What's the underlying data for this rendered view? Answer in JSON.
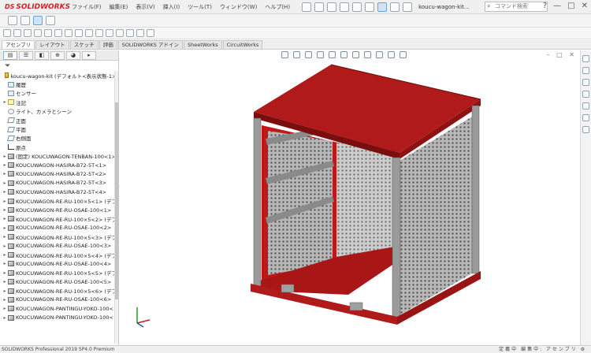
{
  "app": {
    "logo_ds": "DS",
    "logo_text": "SOLIDWORKS",
    "file_name": "koucu-wagon-kit…",
    "search_placeholder": "コマンド検索",
    "window_controls": [
      "?",
      "—",
      "□",
      "✕"
    ]
  },
  "menu": [
    "ファイル(F)",
    "編集(E)",
    "表示(V)",
    "挿入(I)",
    "ツール(T)",
    "ウィンドウ(W)",
    "ヘルプ(H)"
  ],
  "command_tabs": [
    "アセンブリ",
    "レイアウト",
    "スケッチ",
    "評価",
    "SOLIDWORKS アドイン",
    "SheetWorks",
    "CircuitWorks"
  ],
  "feature_manager": {
    "tabs": [
      "FeatureManager",
      "PropertyManager",
      "ConfigurationManager",
      "DimXpert",
      "DisplayManager"
    ],
    "filter_icon": "filter-icon",
    "tree": [
      {
        "label": "koucu-wagon-kit (デフォルト<表示状態-1>)",
        "icon": "assembly",
        "arrow": ""
      },
      {
        "label": "履歴",
        "icon": "history",
        "arrow": ""
      },
      {
        "label": "センサー",
        "icon": "sensor",
        "arrow": ""
      },
      {
        "label": "注記",
        "icon": "note",
        "arrow": "▸"
      },
      {
        "label": "ライト、カメラとシーン",
        "icon": "light",
        "arrow": ""
      },
      {
        "label": "正面",
        "icon": "plane",
        "arrow": ""
      },
      {
        "label": "平面",
        "icon": "plane",
        "arrow": ""
      },
      {
        "label": "右側面",
        "icon": "plane",
        "arrow": ""
      },
      {
        "label": "原点",
        "icon": "origin",
        "arrow": ""
      },
      {
        "label": "(固定) KOUCUWAGON-TENBAN-100<1>",
        "icon": "part",
        "arrow": "▸"
      },
      {
        "label": "KOUCUWAGON-HASIRA-B72-5T<1>",
        "icon": "part",
        "arrow": "▸"
      },
      {
        "label": "KOUCUWAGON-HASIRA-B72-5T<2>",
        "icon": "part",
        "arrow": "▸"
      },
      {
        "label": "KOUCUWAGON-HASIRA-B72-5T<3>",
        "icon": "part",
        "arrow": "▸"
      },
      {
        "label": "KOUCUWAGON-HASIRA-B72-5T<4>",
        "icon": "part",
        "arrow": "▸"
      },
      {
        "label": "KOUCUWAGON-RE-RU-100×5<1> (デフ",
        "icon": "part",
        "arrow": "▸"
      },
      {
        "label": "KOUCUWAGON-RE-RU-OSAE-100<1>",
        "icon": "part",
        "arrow": "▸"
      },
      {
        "label": "KOUCUWAGON-RE-RU-100×5<2> (デフ",
        "icon": "part",
        "arrow": "▸"
      },
      {
        "label": "KOUCUWAGON-RE-RU-OSAE-100<2>",
        "icon": "part",
        "arrow": "▸"
      },
      {
        "label": "KOUCUWAGON-RE-RU-100×5<3> (デフ",
        "icon": "part",
        "arrow": "▸"
      },
      {
        "label": "KOUCUWAGON-RE-RU-OSAE-100<3>",
        "icon": "part",
        "arrow": "▸"
      },
      {
        "label": "KOUCUWAGON-RE-RU-100×5<4> (デフ",
        "icon": "part",
        "arrow": "▸"
      },
      {
        "label": "KOUCUWAGON-RE-RU-OSAE-100<4>",
        "icon": "part",
        "arrow": "▸"
      },
      {
        "label": "KOUCUWAGON-RE-RU-100×5<5> (デフ",
        "icon": "part",
        "arrow": "▸"
      },
      {
        "label": "KOUCUWAGON-RE-RU-OSAE-100<5>",
        "icon": "part",
        "arrow": "▸"
      },
      {
        "label": "KOUCUWAGON-RE-RU-100×5<6> (デフ",
        "icon": "part",
        "arrow": "▸"
      },
      {
        "label": "KOUCUWAGON-RE-RU-OSAE-100<6>",
        "icon": "part",
        "arrow": "▸"
      },
      {
        "label": "KOUCUWAGON-PANTINGU-YOKO-100<",
        "icon": "part",
        "arrow": "▸"
      },
      {
        "label": "KOUCUWAGON-PANTINGU-YOKO-100<",
        "icon": "part",
        "arrow": "▸"
      }
    ]
  },
  "status_bar": {
    "left": "SOLIDWORKS Professional 2019 SP4.0 Premium",
    "right": "定義中  編集中: アセンブリ  ⚙"
  },
  "colors": {
    "frame_red": "#b01a1a",
    "panel_gray": "#a8a8a8",
    "accent_blue": "#1f5fa8"
  }
}
